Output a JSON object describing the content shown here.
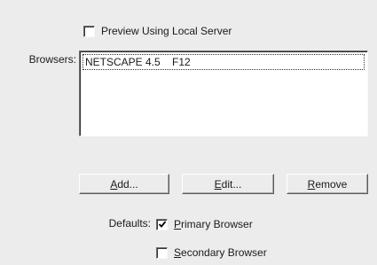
{
  "preview_checkbox": {
    "label": "Preview Using Local Server",
    "checked": false
  },
  "browsers": {
    "label": "Browsers:",
    "items": [
      "NETSCAPE 4.5    F12"
    ]
  },
  "buttons": {
    "add": {
      "underline": "A",
      "rest": "dd..."
    },
    "edit": {
      "underline": "E",
      "rest": "dit..."
    },
    "remove": {
      "underline": "R",
      "rest": "emove"
    }
  },
  "defaults": {
    "label": "Defaults:",
    "primary": {
      "underline": "P",
      "rest": "rimary Browser",
      "checked": true
    },
    "secondary": {
      "underline": "S",
      "rest": "econdary Browser",
      "checked": false
    }
  }
}
